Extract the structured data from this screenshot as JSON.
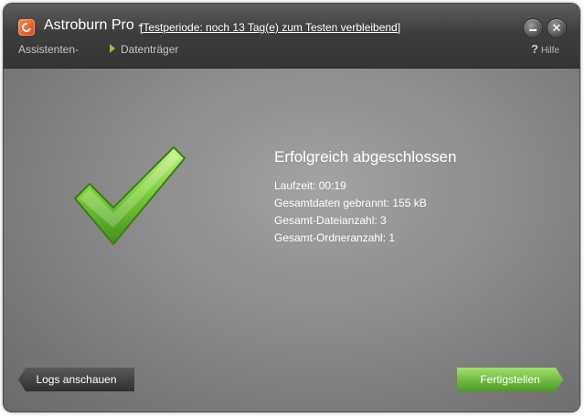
{
  "window": {
    "app_name": "Astroburn Pro -",
    "trial_notice": "[Testperiode: noch 13 Tag(e) zum Testen verbleibend]",
    "help_label": "Hilfe",
    "help_icon": "question-mark-icon"
  },
  "breadcrumb": {
    "step1": "Assistenten-",
    "step2": "Datenträger"
  },
  "result": {
    "title": "Erfolgreich abgeschlossen",
    "icon": "checkmark-icon",
    "stats": [
      "Laufzeit: 00:19",
      "Gesamtdaten gebrannt: 155 kB",
      "Gesamt-Dateianzahl: 3",
      "Gesamt-Ordneranzahl: 1"
    ]
  },
  "buttons": {
    "logs": "Logs anschauen",
    "finish": "Fertigstellen"
  },
  "colors": {
    "accent_green": "#6bbd33",
    "titlebar": "#3d3d3d",
    "content_background": "#8a8a8a"
  }
}
